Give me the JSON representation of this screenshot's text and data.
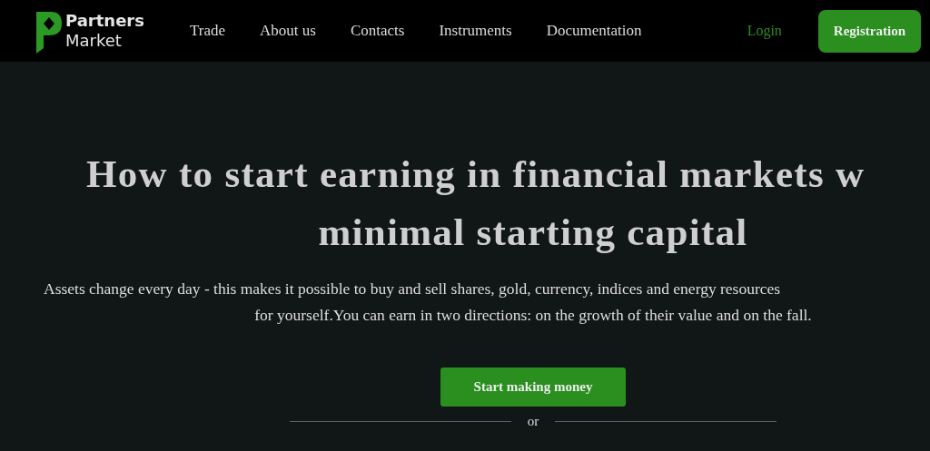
{
  "header": {
    "logo": {
      "line_1": "Partners",
      "line_2": "Market"
    },
    "nav": [
      "Trade",
      "About us",
      "Contacts",
      "Instruments",
      "Documentation"
    ],
    "login": "Login",
    "registration": "Registration"
  },
  "hero": {
    "title_lines": [
      "How to start earning in financial markets w",
      "minimal starting capital"
    ],
    "description_lines": [
      "Assets change every day - this makes it possible to buy and sell shares, gold, currency, indices and energy resources",
      "for yourself.You can earn in two directions: on the growth of their value and on the fall."
    ],
    "cta": "Start making money",
    "divider_text": "or"
  }
}
